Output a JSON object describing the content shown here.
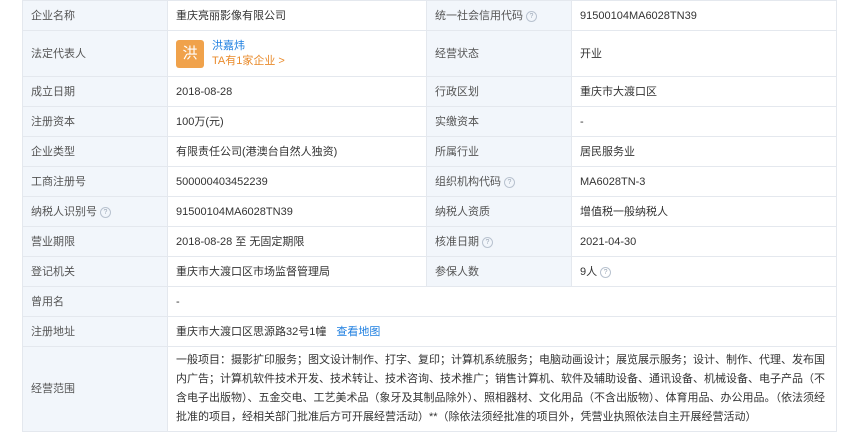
{
  "rows": [
    {
      "l1": "企业名称",
      "v1": "重庆亮丽影像有限公司",
      "l2": "统一社会信用代码",
      "v2": "91500104MA6028TN39"
    },
    {
      "l1": "法定代表人",
      "l2": "经营状态",
      "v2": "开业"
    },
    {
      "l1": "成立日期",
      "v1": "2018-08-28",
      "l2": "行政区划",
      "v2": "重庆市大渡口区"
    },
    {
      "l1": "注册资本",
      "v1": "100万(元)",
      "l2": "实缴资本",
      "v2": "-"
    },
    {
      "l1": "企业类型",
      "v1": "有限责任公司(港澳台自然人独资)",
      "l2": "所属行业",
      "v2": "居民服务业"
    },
    {
      "l1": "工商注册号",
      "v1": "500000403452239",
      "l2": "组织机构代码",
      "v2": "MA6028TN-3"
    },
    {
      "l1": "纳税人识别号",
      "v1": "91500104MA6028TN39",
      "l2": "纳税人资质",
      "v2": "增值税一般纳税人"
    },
    {
      "l1": "营业期限",
      "v1": "2018-08-28 至 无固定期限",
      "l2": "核准日期",
      "v2": "2021-04-30"
    },
    {
      "l1": "登记机关",
      "v1": "重庆市大渡口区市场监督管理局",
      "l2": "参保人数",
      "v2": "9人"
    },
    {
      "l1": "曾用名",
      "v1": "-"
    },
    {
      "l1": "注册地址",
      "v1": "重庆市大渡口区思源路32号1幢"
    },
    {
      "l1": "经营范围",
      "v1": "一般项目：摄影扩印服务；图文设计制作、打字、复印；计算机系统服务；电脑动画设计；展览展示服务；设计、制作、代理、发布国内广告；计算机软件技术开发、技术转让、技术咨询、技术推广；销售计算机、软件及辅助设备、通讯设备、机械设备、电子产品（不含电子出版物）、五金交电、工艺美术品（象牙及其制品除外）、照相器材、文化用品（不含出版物）、体育用品、办公用品。（依法须经批准的项目，经相关部门批准后方可开展经营活动）**（除依法须经批准的项目外，凭营业执照依法自主开展经营活动）"
    }
  ],
  "legal_rep": {
    "avatar_char": "洪",
    "name": "洪嘉炜",
    "companies": "TA有1家企业 >"
  },
  "map_link": "查看地图",
  "help_glyph": "?",
  "icons": {
    "help": "question-circle-icon"
  },
  "colors": {
    "label_bg": "#f2f6fb",
    "border": "#e4e8ee",
    "link": "#1f7fe0",
    "avatar": "#f0a24b"
  }
}
